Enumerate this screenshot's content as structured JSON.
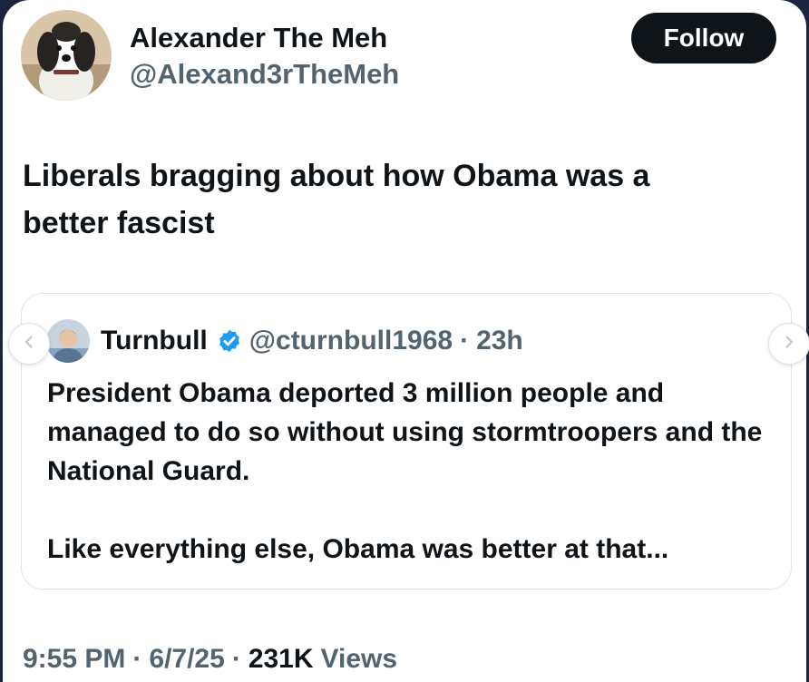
{
  "author": {
    "name": "Alexander The Meh",
    "handle": "@Alexand3rTheMeh"
  },
  "follow_button": {
    "label": "Follow"
  },
  "tweet": {
    "lines": [
      "Liberals bragging about how Obama was a",
      "better fascist"
    ]
  },
  "quoted_tweet": {
    "name": "Turnbull",
    "handle": "@cturnbull1968",
    "separator": "·",
    "time": "23h",
    "paragraphs": [
      "President Obama deported 3 million people and managed to do so without using stormtroopers and the National Guard.",
      "Like everything else, Obama was better at that..."
    ],
    "verified_badge_color": "#1d9bf0",
    "icons": [
      "verified-badge-icon"
    ]
  },
  "carousel": {
    "prev_icon": "chevron-left-icon",
    "next_icon": "chevron-right-icon"
  },
  "meta": {
    "time": "9:55 PM",
    "date": "6/7/25",
    "separator": "·",
    "views_count": "231K",
    "views_label": "Views"
  },
  "colors": {
    "text_primary": "#0f1419",
    "text_secondary": "#536471",
    "follow_bg": "#0f1419",
    "page_background": "#1b2340"
  }
}
